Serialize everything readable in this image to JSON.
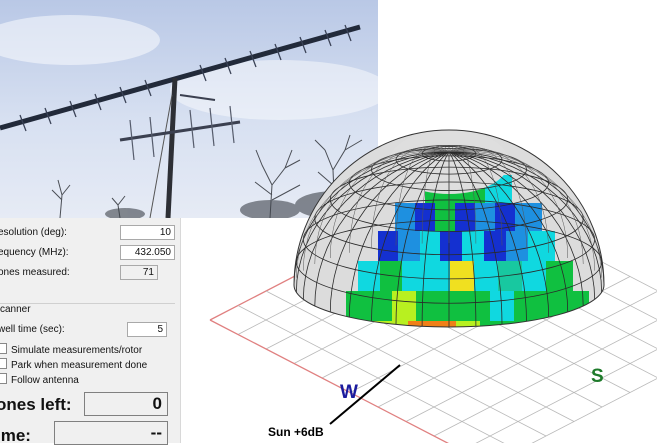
{
  "photo": {
    "subject": "crossed Yagi antenna array against sky"
  },
  "settings": {
    "resolution": {
      "label": "esolution (deg):",
      "value": "10"
    },
    "frequency": {
      "label": "equency (MHz):",
      "value": "432.050"
    },
    "zones_measured": {
      "label": "ones measured:",
      "value": "71"
    }
  },
  "scanner": {
    "title": "canner",
    "dwell": {
      "label": "well time (sec):",
      "value": "5"
    },
    "options": [
      {
        "label": "Simulate measurements/rotor",
        "checked": false
      },
      {
        "label": "Park when measurement done",
        "checked": false
      },
      {
        "label": "Follow antenna",
        "checked": false
      }
    ],
    "zones_left": {
      "label": "ones left:",
      "value": "0"
    },
    "time": {
      "label": "ime:",
      "value": "--"
    }
  },
  "plot": {
    "compass": {
      "west": "W",
      "south": "S"
    },
    "annotation": "Sun +6dB",
    "colors": {
      "grid_gray": "#d8d8d8",
      "plane_red": "#e08080",
      "plane_gray": "#b8b8b8",
      "west_blue": "#1b1b9e",
      "south_green": "#1e7a2a"
    }
  }
}
